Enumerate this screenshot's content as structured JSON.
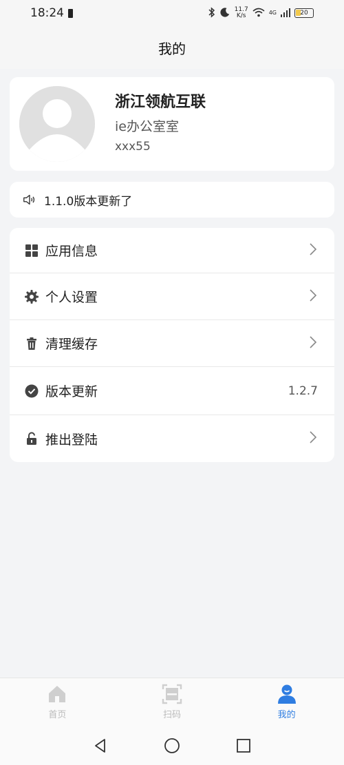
{
  "status_bar": {
    "time": "18:24",
    "net_speed_top": "11.7",
    "net_speed_bottom": "K/s",
    "network": "4G",
    "battery": "20"
  },
  "header": {
    "title": "我的"
  },
  "profile": {
    "company": "浙江领航互联",
    "department": "ie办公室室",
    "user_id": "xxx55"
  },
  "notice": {
    "text": "1.1.0版本更新了"
  },
  "menu": {
    "items": [
      {
        "label": "应用信息",
        "icon": "grid-icon"
      },
      {
        "label": "个人设置",
        "icon": "gear-icon"
      },
      {
        "label": "清理缓存",
        "icon": "trash-icon"
      },
      {
        "label": "版本更新",
        "icon": "check-circle-icon",
        "value": "1.2.7"
      },
      {
        "label": "推出登陆",
        "icon": "unlock-icon"
      }
    ]
  },
  "bottom_nav": {
    "items": [
      {
        "label": "首页",
        "icon": "home-icon"
      },
      {
        "label": "扫码",
        "icon": "scan-icon"
      },
      {
        "label": "我的",
        "icon": "user-icon",
        "active": true
      }
    ]
  },
  "colors": {
    "accent": "#2f7de1",
    "background": "#f3f4f6",
    "card": "#ffffff"
  }
}
